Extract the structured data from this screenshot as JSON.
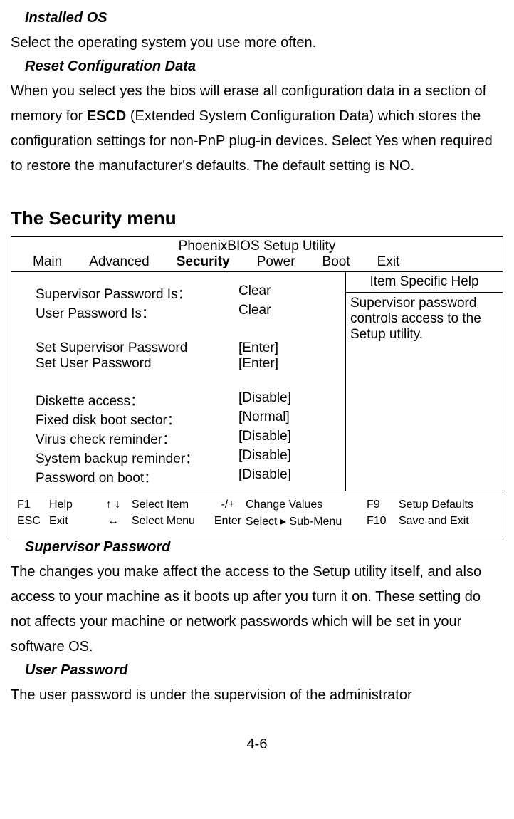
{
  "sections": {
    "installed_os": {
      "title": "Installed OS",
      "body": "Select the operating system you use more often."
    },
    "reset_config": {
      "title": "Reset Configuration Data",
      "body_pre": "When you select yes the bios will erase all configuration data in a section of memory for ",
      "escd": "ESCD",
      "body_post": " (Extended System Configuration Data) which stores the configuration settings for non-PnP plug-in devices. Select Yes when required to restore the manufacturer's defaults. The default setting is NO."
    },
    "security_heading": "The Security menu",
    "supervisor_pw": {
      "title": "Supervisor Password",
      "body": "The changes you make affect the access to the Setup utility itself, and also access to your machine as it boots up after you turn it on. These setting do not affects your machine or network passwords which will be set in your software OS."
    },
    "user_pw": {
      "title": "User Password",
      "body": "The user password is under the supervision of the administrator"
    }
  },
  "bios": {
    "title": "PhoenixBIOS Setup Utility",
    "tabs": [
      "Main",
      "Advanced",
      "Security",
      "Power",
      "Boot",
      "Exit"
    ],
    "selected_tab": "Security",
    "items": [
      {
        "label": "Supervisor Password Is：",
        "value": "Clear"
      },
      {
        "label": "User Password Is：",
        "value": "Clear"
      }
    ],
    "items2": [
      {
        "label": "Set Supervisor Password",
        "value": "[Enter]"
      },
      {
        "label": "Set User Password",
        "value": "[Enter]"
      }
    ],
    "items3": [
      {
        "label": "Diskette access：",
        "value": "[Disable]"
      },
      {
        "label": "Fixed disk boot sector：",
        "value": "[Normal]"
      },
      {
        "label": "Virus check reminder：",
        "value": "[Disable]"
      },
      {
        "label": "System backup reminder：",
        "value": "[Disable]"
      },
      {
        "label": "Password on boot：",
        "value": "[Disable]"
      }
    ],
    "help_title": "Item Specific Help",
    "help_body": "Supervisor password controls access to the Setup utility.",
    "footer": {
      "row1": {
        "k1": "F1",
        "k2": "Help",
        "k3": "↑ ↓",
        "k4": "Select Item",
        "k5": "-/+",
        "k6": "Change Values",
        "k7": "F9",
        "k8": "Setup Defaults"
      },
      "row2": {
        "k1": "ESC",
        "k2": "Exit",
        "k3": "↔",
        "k4": "Select Menu",
        "k5": "Enter",
        "k6": "Select ▸ Sub-Menu",
        "k7": "F10",
        "k8": "Save and Exit"
      }
    }
  },
  "page_number": "4-6"
}
